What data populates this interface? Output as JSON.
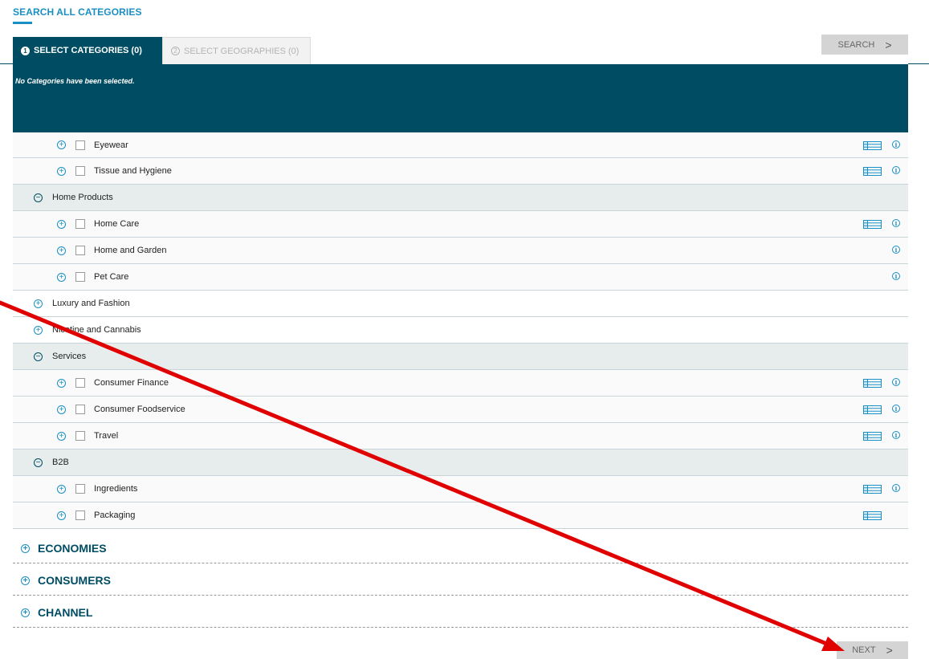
{
  "header": {
    "title": "SEARCH ALL CATEGORIES"
  },
  "tabs": [
    {
      "number": "1",
      "label": "SELECT CATEGORIES (0)"
    },
    {
      "number": "2",
      "label": "SELECT GEOGRAPHIES (0)"
    }
  ],
  "search_button": {
    "label": "SEARCH",
    "chevron": ">"
  },
  "panel": {
    "message": "No Categories have been selected."
  },
  "tree": {
    "rows": [
      {
        "label": "Eyewear"
      },
      {
        "label": "Tissue and Hygiene"
      },
      {
        "label": "Home Products"
      },
      {
        "label": "Home Care"
      },
      {
        "label": "Home and Garden"
      },
      {
        "label": "Pet Care"
      },
      {
        "label": "Luxury and Fashion"
      },
      {
        "label": "Nicotine and Cannabis"
      },
      {
        "label": "Services"
      },
      {
        "label": "Consumer Finance"
      },
      {
        "label": "Consumer Foodservice"
      },
      {
        "label": "Travel"
      },
      {
        "label": "B2B"
      },
      {
        "label": "Ingredients"
      },
      {
        "label": "Packaging"
      }
    ]
  },
  "accordions": [
    {
      "label": "ECONOMIES"
    },
    {
      "label": "CONSUMERS"
    },
    {
      "label": "CHANNEL"
    }
  ],
  "next_button": {
    "label": "NEXT",
    "chevron": ">"
  },
  "colors": {
    "brand": "#004d63",
    "accent": "#1a8fc4",
    "annotation_arrow": "#e00000"
  },
  "icons": {
    "expand": "plus-circle-icon",
    "collapse": "minus-circle-icon",
    "table": "table-icon",
    "info": "info-icon"
  }
}
